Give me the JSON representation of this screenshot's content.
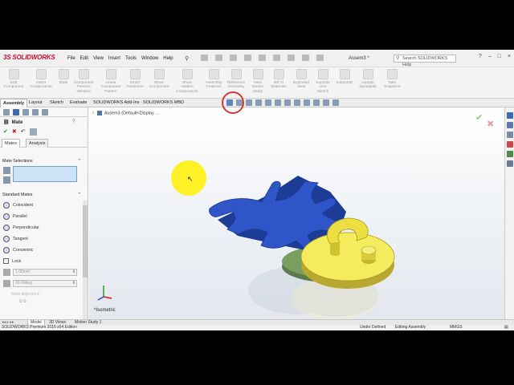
{
  "app": {
    "brand_prefix": "3S",
    "brand": "SOLIDWORKS",
    "document_title": "Assem3 *"
  },
  "menu": [
    "File",
    "Edit",
    "View",
    "Insert",
    "Tools",
    "Window",
    "Help"
  ],
  "search": {
    "placeholder": "Search SOLIDWORKS Help"
  },
  "window_controls": [
    "?",
    "–",
    "□",
    "×"
  ],
  "ribbon": [
    {
      "label": "Edit\nComponent"
    },
    {
      "label": "Insert\nComponents"
    },
    {
      "label": "Mate"
    },
    {
      "label": "Component\nPreview\nWindow"
    },
    {
      "label": "Linear\nComponent\nPattern"
    },
    {
      "label": "Smart\nFasteners"
    },
    {
      "label": "Move\nComponent"
    },
    {
      "label": "Show\nHidden\nComponents"
    },
    {
      "label": "Assembly\nFeatures"
    },
    {
      "label": "Reference\nGeometry"
    },
    {
      "label": "New\nMotion\nStudy"
    },
    {
      "label": "Bill of\nMaterials"
    },
    {
      "label": "Exploded\nView"
    },
    {
      "label": "Explode\nLine\nSketch"
    },
    {
      "label": "Instant3D"
    },
    {
      "label": "Update\nSpeedpak"
    },
    {
      "label": "Take\nSnapshot"
    }
  ],
  "command_tabs": [
    "Assembly",
    "Layout",
    "Sketch",
    "Evaluate",
    "SOLIDWORKS Add-Ins",
    "SOLIDWORKS MBD"
  ],
  "active_command_tab": "Assembly",
  "property_manager": {
    "title": "Mate",
    "help": "?",
    "tabs": [
      "Mates",
      "Analysis"
    ],
    "mate_selections_label": "Mate Selections",
    "standard_mates_label": "Standard Mates",
    "standard_mates": [
      "Coincident",
      "Parallel",
      "Perpendicular",
      "Tangent",
      "Concentric",
      "Lock"
    ],
    "distance_value": "1.00mm",
    "angle_value": "30.00deg",
    "mate_alignment_label": "Mate alignment:"
  },
  "viewport": {
    "tree_root": "Assem3  (Default<Display ...",
    "view_label": "*Isometric"
  },
  "bottom_tabs": [
    "Model",
    "3D Views",
    "Motion Study 1"
  ],
  "active_bottom_tab": "Model",
  "status": {
    "edition": "SOLIDWORKS Premium 2016 x64 Edition",
    "definition": "Under Defined",
    "mode": "Editing Assembly",
    "units": "MMGS"
  },
  "colors": {
    "accent": "#c8102e",
    "part_blue": "#2f55c8",
    "part_yellow": "#f4ec5c",
    "highlight": "#d23a3a"
  }
}
